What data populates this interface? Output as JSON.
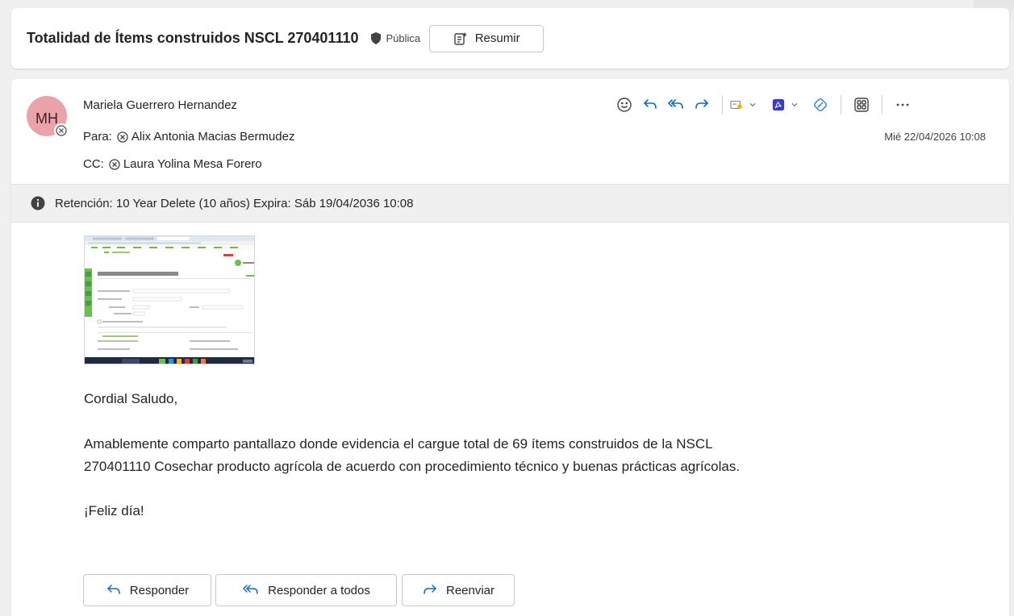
{
  "subject": {
    "title": "Totalidad de Ítems construidos NSCL 270401110",
    "sensitivity": "Pública",
    "summarize_label": "Resumir"
  },
  "message": {
    "avatar_initials": "MH",
    "sender": "Mariela Guerrero Hernandez",
    "to_label": "Para:",
    "to": "Alix Antonia Macias Bermudez",
    "cc_label": "CC:",
    "cc": "Laura Yolina Mesa Forero",
    "date": "Mié 22/04/2026 10:08",
    "retention": "Retención: 10 Year Delete (10 años) Expira: Sáb 19/04/2036 10:08"
  },
  "toolbar": {
    "icons": [
      "emoji-icon",
      "reply-icon",
      "reply-all-icon",
      "forward-icon",
      "apps-icon",
      "pdf-icon",
      "loop-icon",
      "immersive-reader-icon",
      "more-icon"
    ]
  },
  "body": {
    "greeting": "Cordial Saludo,",
    "line1": "Amablemente comparto pantallazo donde evidencia el cargue total de 69 ítems construidos de la NSCL",
    "line2": "270401110 Cosechar producto agrícola de acuerdo con procedimiento técnico y buenas prácticas agrícolas.",
    "closing": "¡Feliz día!"
  },
  "reply_buttons": {
    "reply": "Responder",
    "reply_all": "Responder a todos",
    "forward": "Reenviar"
  },
  "colors": {
    "accent": "#0f6cbd",
    "avatar_bg": "#e9a3a9",
    "pdf_red": "#3b3bc4",
    "green": "#6cc04a"
  }
}
